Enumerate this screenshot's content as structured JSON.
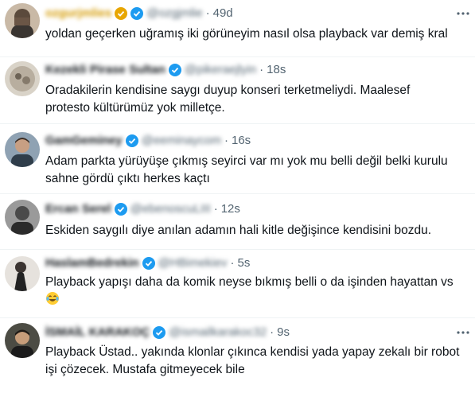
{
  "colors": {
    "verified_badge": "#1d9bf0",
    "gold_badge": "#e8a600",
    "secondary_text": "#536471",
    "primary_text": "#0f1419"
  },
  "tweets": [
    {
      "name": "ozgurjmlies",
      "handle": "@ozgjmlie",
      "separator": "·",
      "time": "49d",
      "text_lines": [
        "yoldan geçerken uğramış iki görüneyim nasıl olsa playback var demiş kral"
      ]
    },
    {
      "name": "Kezekli Pirase Sultan",
      "handle": "@pikeraejlyin",
      "separator": "·",
      "time": "18s",
      "text_lines": [
        "Oradakilerin kendisine saygı duyup konseri terketmeliydi. Maalesef",
        "protesto kültürümüz yok milletçe."
      ]
    },
    {
      "name": "GamGeminey",
      "handle": "@eeminaycom",
      "separator": "·",
      "time": "16s",
      "text_lines": [
        "Adam parkta yürüyüşe çıkmış seyirci var mı yok mu belli değil belki kurulu",
        "sahne gördü çıktı herkes kaçtı"
      ]
    },
    {
      "name": "Ercan Serel",
      "handle": "@ebenoscuLIII",
      "separator": "·",
      "time": "12s",
      "text_lines": [
        "Eskiden saygılı diye anılan adamın hali kitle değişince kendisini bozdu."
      ]
    },
    {
      "name": "HaslamBedrekin",
      "handle": "@HBimekiev",
      "separator": "·",
      "time": "5s",
      "text_lines": [
        "Playback yapışı daha da komik neyse bıkmış belli o da işinden hayattan vs",
        ""
      ],
      "emoji": "face-with-tears-of-joy"
    },
    {
      "name": "İSMAİL KARAKOÇ",
      "handle": "@ismailkarakoc32",
      "separator": "·",
      "time": "9s",
      "text_lines": [
        "Playback Üstad.. yakında klonlar çıkınca kendisi yada yapay zekalı bir robot",
        "işi çözecek. Mustafa gitmeyecek bile"
      ]
    }
  ]
}
